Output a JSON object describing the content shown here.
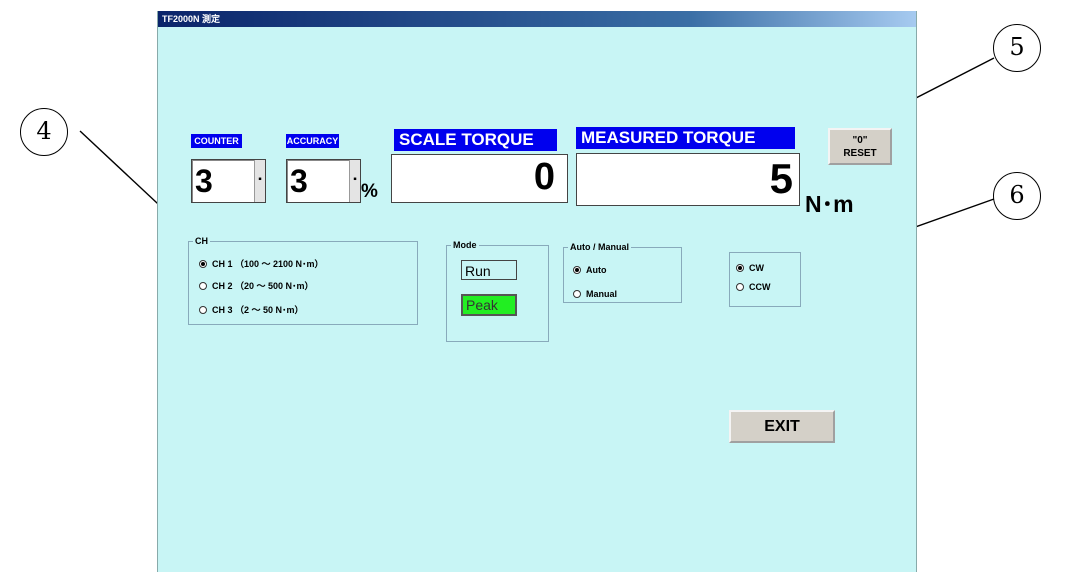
{
  "window": {
    "title": "TF2000N 測定"
  },
  "counter": {
    "label": "COUNTER",
    "value": "3"
  },
  "accuracy": {
    "label": "ACCURACY",
    "value": "3",
    "unit": "%"
  },
  "scale_torque": {
    "label": "SCALE TORQUE",
    "value": "0"
  },
  "measured_torque": {
    "label": "MEASURED  TORQUE",
    "value": "5",
    "unit": "N･m"
  },
  "reset_button": {
    "line1": "\"0\"",
    "line2": "RESET"
  },
  "ch_group": {
    "legend": "CH",
    "options": [
      {
        "label": "CH 1 （100 ～ 2100 N･m）",
        "selected": true
      },
      {
        "label": "CH 2 （20 ～ 500 N･m）",
        "selected": false
      },
      {
        "label": "CH 3 （2 ～ 50 N･m）",
        "selected": false
      }
    ]
  },
  "mode_group": {
    "legend": "Mode",
    "run": "Run",
    "peak": "Peak",
    "peak_color": "#22ee22"
  },
  "auto_manual_group": {
    "legend": "Auto / Manual",
    "options": [
      {
        "label": "Auto",
        "selected": true
      },
      {
        "label": "Manual",
        "selected": false
      }
    ]
  },
  "direction_group": {
    "options": [
      {
        "label": "CW",
        "selected": true
      },
      {
        "label": "CCW",
        "selected": false
      }
    ]
  },
  "exit_button": {
    "label": "EXIT"
  },
  "callouts": {
    "c4": "4",
    "c5": "5",
    "c6": "6"
  },
  "colors": {
    "window_bg": "#c8f5f5",
    "header_blue": "#0000ee"
  }
}
